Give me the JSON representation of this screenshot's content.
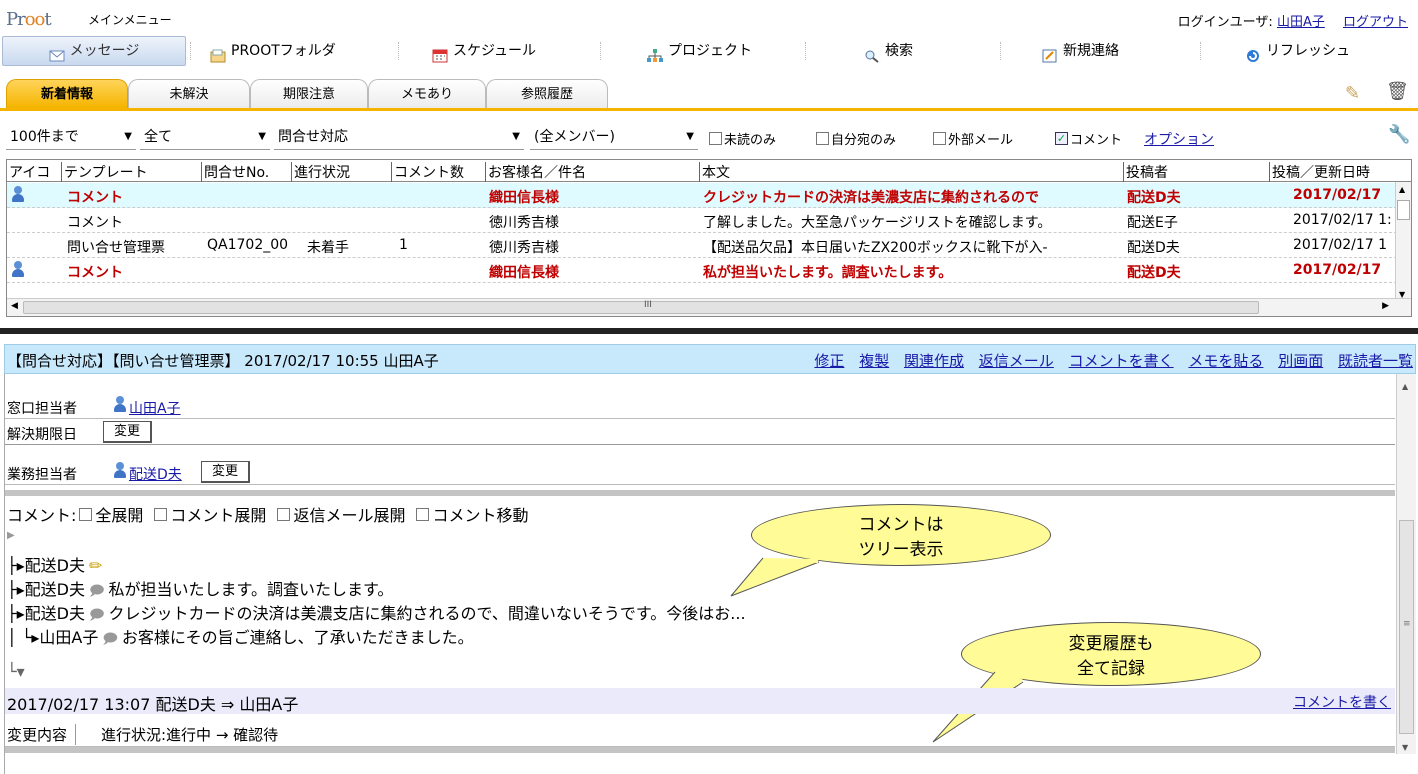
{
  "header": {
    "logo": "Proot",
    "app_title": "メインメニュー",
    "login_label": "ログインユーザ:",
    "user": "山田A子",
    "logout": "ログアウト"
  },
  "menu": [
    {
      "label": "メッセージ",
      "icon": "envelope-icon"
    },
    {
      "label": "PROOTフォルダ",
      "icon": "folder-icon"
    },
    {
      "label": "スケジュール",
      "icon": "calendar-icon"
    },
    {
      "label": "プロジェクト",
      "icon": "org-chart-icon"
    },
    {
      "label": "検索",
      "icon": "magnifier-icon"
    },
    {
      "label": "新規連絡",
      "icon": "new-note-icon"
    },
    {
      "label": "リフレッシュ",
      "icon": "refresh-icon"
    }
  ],
  "tabs": [
    "新着情報",
    "未解決",
    "期限注意",
    "メモあり",
    "参照履歴"
  ],
  "filters": {
    "count": "100件まで",
    "scope": "全て",
    "template": "問合せ対応",
    "member": "(全メンバー)",
    "checks": [
      {
        "label": "未読のみ",
        "checked": false
      },
      {
        "label": "自分宛のみ",
        "checked": false
      },
      {
        "label": "外部メール",
        "checked": false
      },
      {
        "label": "コメント",
        "checked": true
      }
    ],
    "option_link": "オプション"
  },
  "grid": {
    "columns": [
      "アイコ",
      "テンプレート",
      "問合せNo.",
      "進行状況",
      "コメント数",
      "お客様名／件名",
      "本文",
      "投稿者",
      "投稿／更新日時"
    ],
    "rows": [
      {
        "icon": true,
        "template": "コメント",
        "no": "",
        "status": "",
        "count": "",
        "customer": "織田信長様",
        "body": "クレジットカードの決済は美濃支店に集約されるので",
        "poster": "配送D夫",
        "date": "2017/02/17",
        "style": "red sel1"
      },
      {
        "icon": false,
        "template": "コメント",
        "no": "",
        "status": "",
        "count": "",
        "customer": "徳川秀吉様",
        "body": "了解しました。大至急パッケージリストを確認します。",
        "poster": "配送E子",
        "date": "2017/02/17 1:",
        "style": ""
      },
      {
        "icon": false,
        "template": "問い合せ管理票",
        "no": "QA1702_00",
        "status": "未着手",
        "count": "1",
        "customer": "徳川秀吉様",
        "body": "【配送品欠品】本日届いたZX200ボックスに靴下が入-",
        "poster": "配送D夫",
        "date": "2017/02/17 1",
        "style": ""
      },
      {
        "icon": true,
        "template": "コメント",
        "no": "",
        "status": "",
        "count": "",
        "customer": "織田信長様",
        "body": "私が担当いたします。調査いたします。",
        "poster": "配送D夫",
        "date": "2017/02/17",
        "style": "red"
      }
    ],
    "scroll_mark": "III"
  },
  "detail": {
    "title": "【問合せ対応】【問い合せ管理票】 2017/02/17 10:55 山田A子",
    "actions": [
      "修正",
      "複製",
      "関連作成",
      "返信メール",
      "コメントを書く",
      "メモを貼る",
      "別画面",
      "既読者一覧"
    ],
    "fields": [
      {
        "label": "窓口担当者",
        "user": "山田A子",
        "button": ""
      },
      {
        "label": "解決期限日",
        "user": "",
        "button": "変更"
      },
      {
        "label": "業務担当者",
        "user": "配送D夫",
        "button": "変更"
      }
    ],
    "comment_options": {
      "prefix": "コメント:",
      "items": [
        "全展開",
        "コメント展開",
        "返信メール展開",
        "コメント移動"
      ]
    },
    "tree": [
      {
        "prefix": "├▸配送D夫",
        "text": "",
        "type": "edit"
      },
      {
        "prefix": "├▸配送D夫",
        "text": "私が担当いたします。調査いたします。",
        "type": "comment"
      },
      {
        "prefix": "├▸配送D夫",
        "text": "クレジットカードの決済は美濃支店に集約されるので、間違いないそうです。今後はお...",
        "type": "comment"
      },
      {
        "prefix": "│ └▸山田A子",
        "text": "お客様にその旨ご連絡し、了承いただきました。",
        "type": "comment"
      }
    ],
    "tree_end": "└▾",
    "bubble1": [
      "コメントは",
      "ツリー表示"
    ],
    "bubble2": [
      "変更履歴も",
      "全て記録"
    ],
    "history": {
      "header": "2017/02/17 13:07 配送D夫 ⇒ 山田A子",
      "write_link": "コメントを書く",
      "label": "変更内容",
      "change": "進行状況:進行中 → 確認待"
    }
  }
}
